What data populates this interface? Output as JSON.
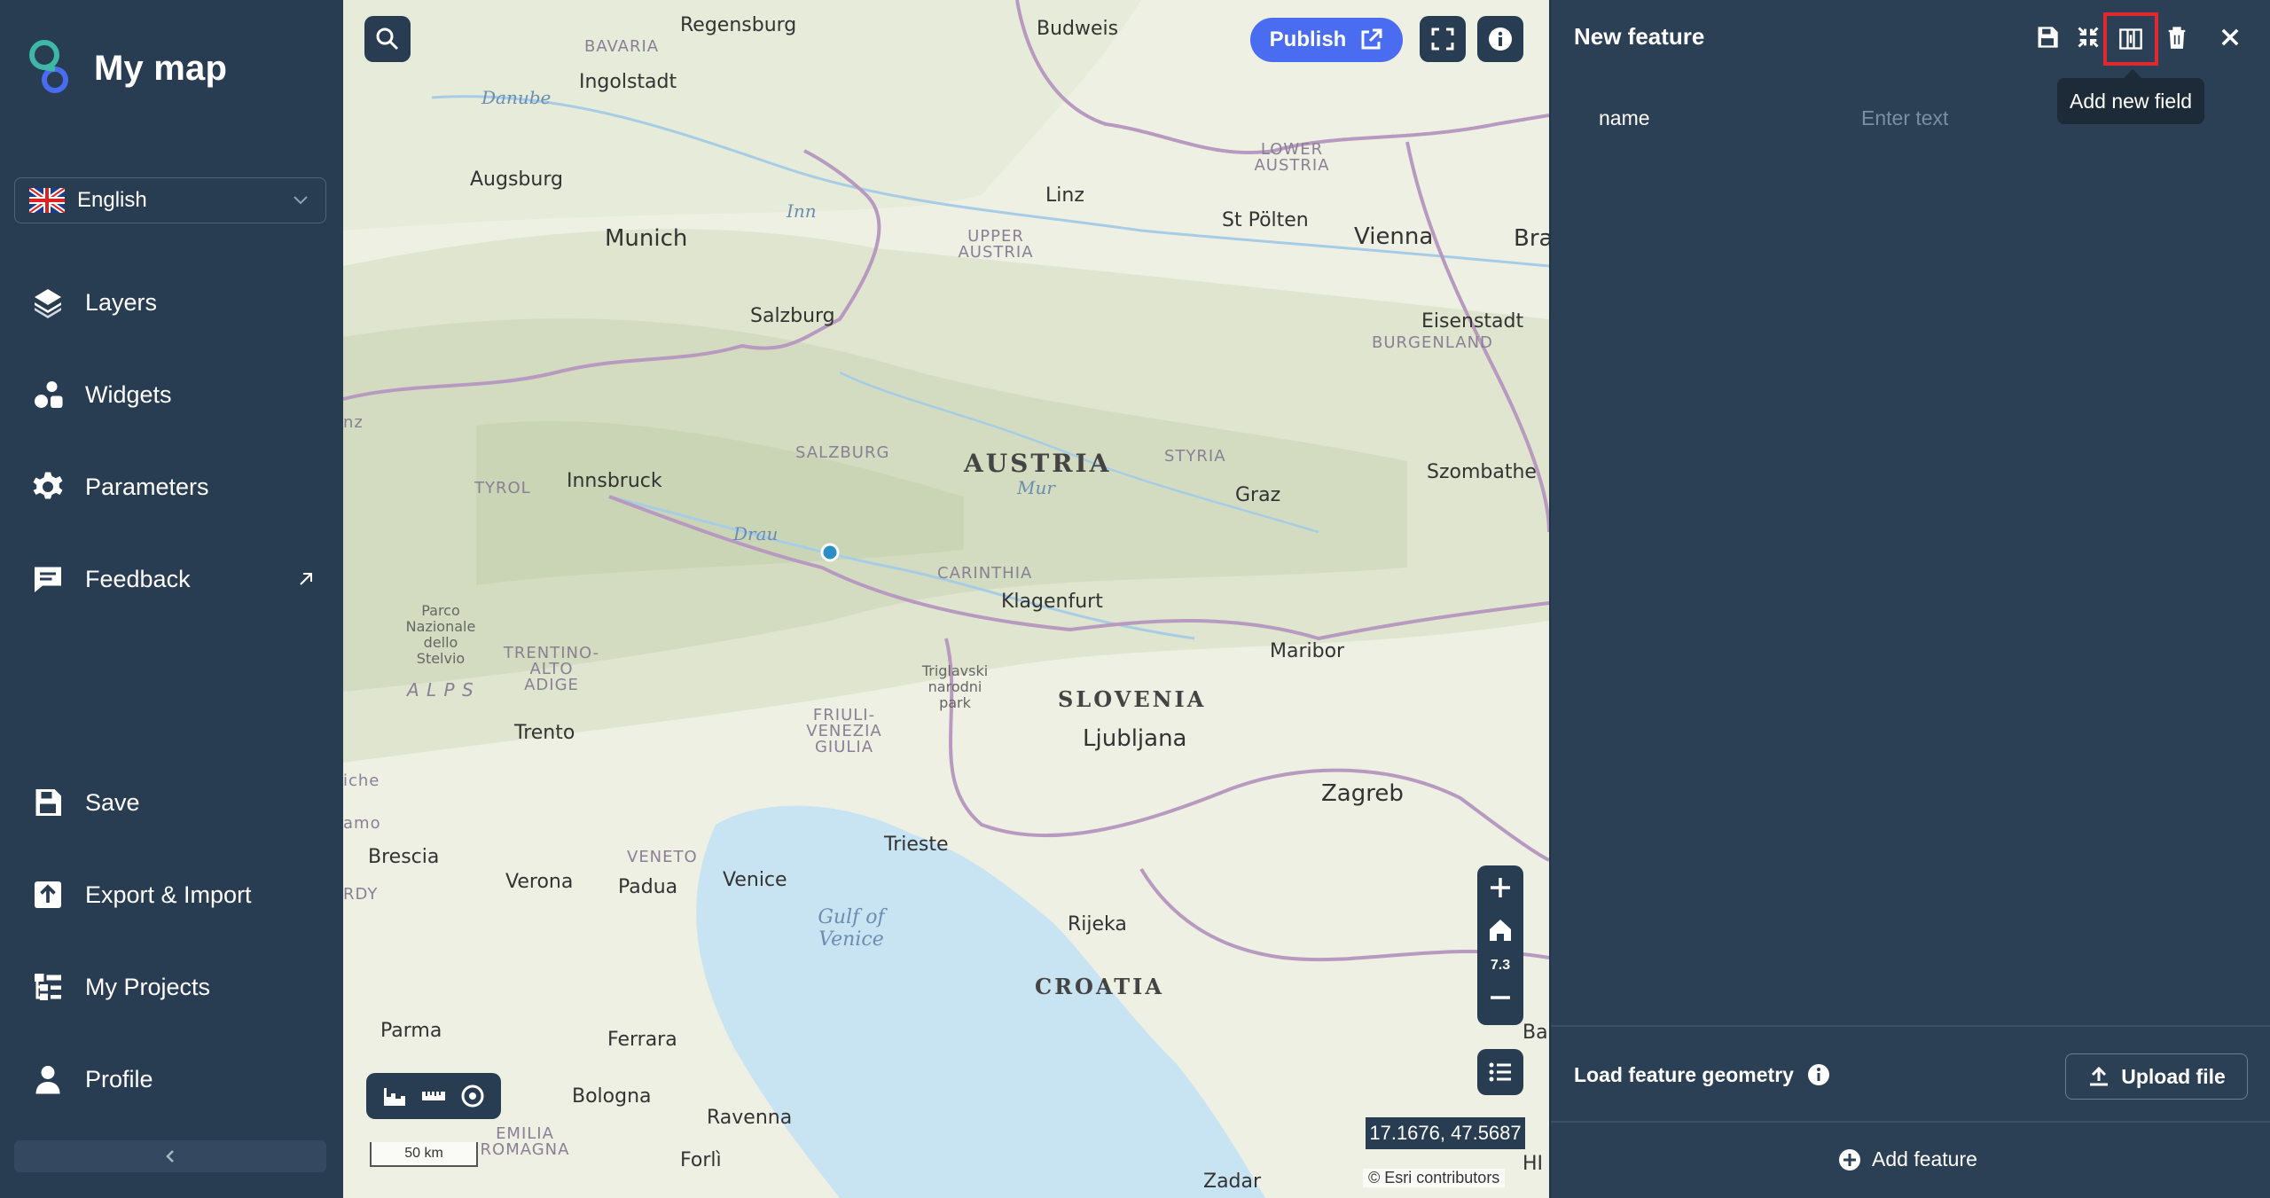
{
  "sidebar": {
    "app_title": "My map",
    "language": "English",
    "nav": [
      {
        "label": "Layers"
      },
      {
        "label": "Widgets"
      },
      {
        "label": "Parameters"
      },
      {
        "label": "Feedback"
      }
    ],
    "bottom_nav": [
      {
        "label": "Save"
      },
      {
        "label": "Export & Import"
      },
      {
        "label": "My Projects"
      },
      {
        "label": "Profile"
      }
    ]
  },
  "map": {
    "publish_label": "Publish",
    "zoom_level": "7.3",
    "coordinates": "17.1676, 47.5687",
    "scale_label": "50 km",
    "attribution": "© Esri contributors",
    "labels": {
      "cities": [
        "Regensburg",
        "Budweis",
        "Ingolstadt",
        "Augsburg",
        "Munich",
        "Linz",
        "St Pölten",
        "Vienna",
        "Bra",
        "Salzburg",
        "Eisenstadt",
        "Innsbruck",
        "Graz",
        "Szombathe",
        "Klagenfurt",
        "Maribor",
        "Ljubljana",
        "Trento",
        "Zagreb",
        "Brescia",
        "Verona",
        "Padua",
        "Venice",
        "Trieste",
        "Rijeka",
        "Parma",
        "Ferrara",
        "Bologna",
        "Ravenna",
        "Forlì",
        "Zadar",
        "Ba",
        "HI"
      ],
      "countries": [
        "AUSTRIA",
        "SLOVENIA",
        "CROATIA",
        "A L P S"
      ],
      "regions": [
        "BAVARIA",
        "LOWER AUSTRIA",
        "UPPER AUSTRIA",
        "BURGENLAND",
        "SALZBURG",
        "STYRIA",
        "TYROL",
        "CARINTHIA",
        "TRENTINO-ALTO ADIGE",
        "FRIULI-VENEZIA GIULIA",
        "VENETO",
        "EMILIA ROMAGNA",
        "Parco Nazionale dello Stelvio",
        "Triglavski narodni park",
        "nz",
        "RDY",
        "amo",
        "iche"
      ],
      "water": [
        "Danube",
        "Inn",
        "Mur",
        "Drau",
        "Gulf of Venice"
      ]
    }
  },
  "panel": {
    "title": "New feature",
    "tooltip": "Add new field",
    "field_name": "name",
    "field_placeholder": "Enter text",
    "load_geometry_label": "Load feature geometry",
    "upload_label": "Upload file",
    "add_feature_label": "Add feature"
  },
  "colors": {
    "sidebar_bg": "#283c52",
    "publish_bg": "#4a6cf0",
    "highlight": "#e0282e",
    "map_location_dot": "#2b8fc6"
  }
}
